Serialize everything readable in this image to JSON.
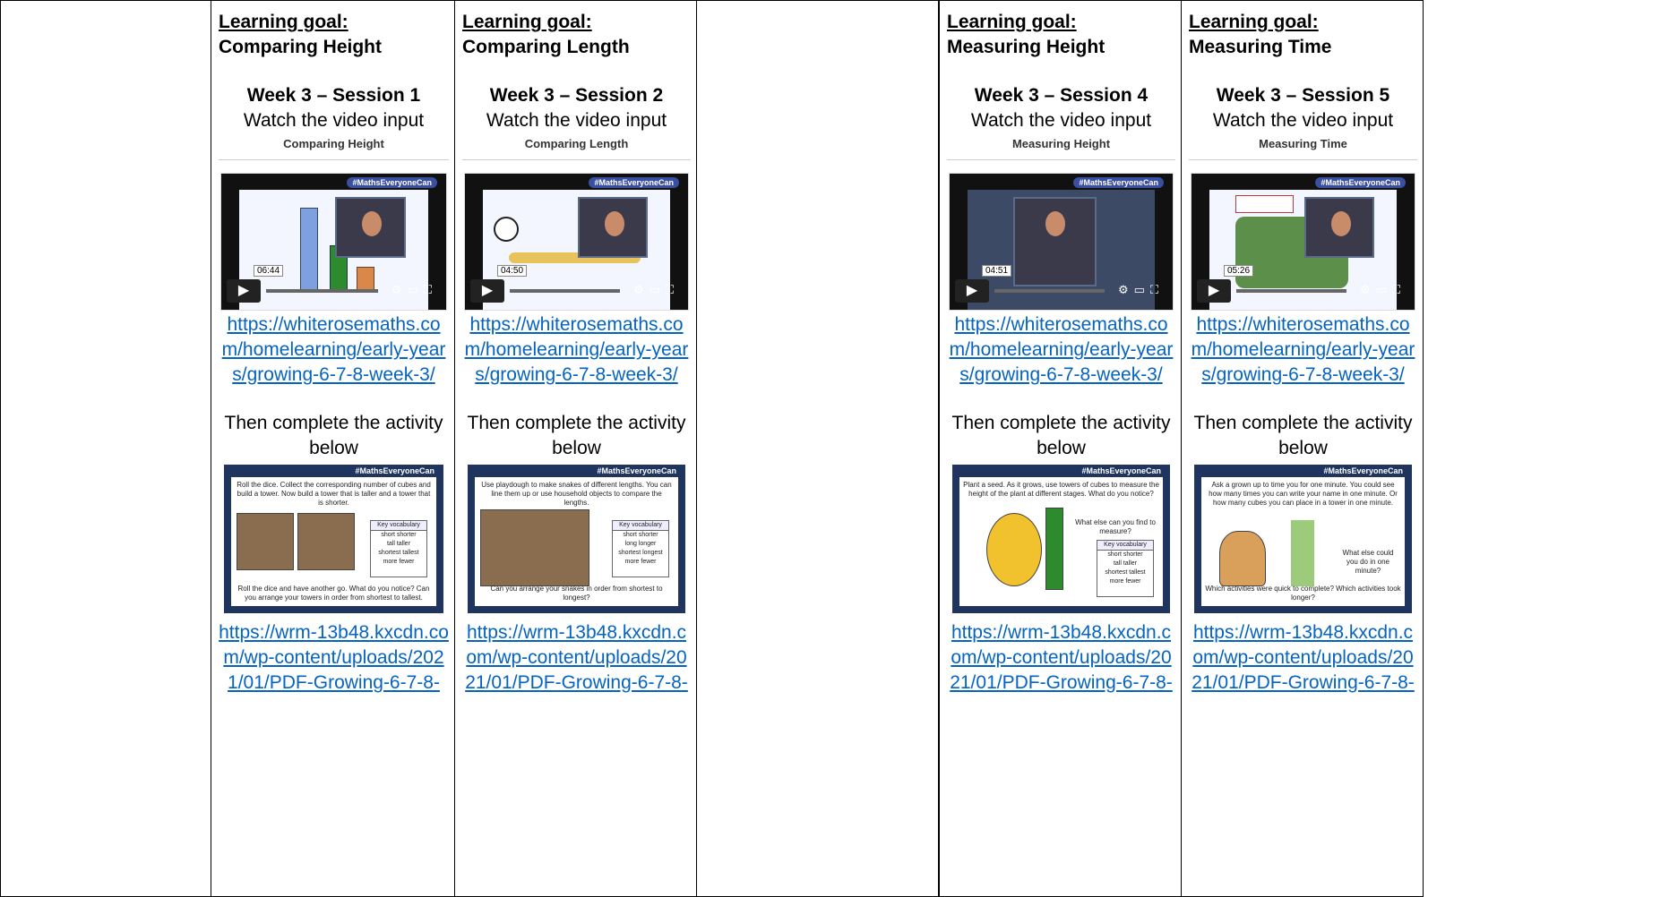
{
  "brand_text": "#MathsEveryoneCan",
  "goal_label": "Learning goal:",
  "columns": [
    {
      "goal": "Comparing Height",
      "week": "Week 3 – Session 1",
      "instruction": "Watch the video input",
      "video_heading": "Comparing Height",
      "video_time": "06:44",
      "video_link": "https://whiterosemaths.com/homelearning/early-years/growing-6-7-8-week-3/",
      "then": "Then complete the activity below",
      "activity_link": "https://wrm-13b48.kxcdn.com/wp-content/uploads/2021/01/PDF-Growing-6-7-8-"
    },
    {
      "goal": "Comparing Length",
      "week": "Week 3 – Session 2",
      "instruction": "Watch the video input",
      "video_heading": "Comparing Length",
      "video_time": "04:50",
      "video_link": "https://whiterosemaths.com/homelearning/early-years/growing-6-7-8-week-3/",
      "then": "Then complete the activity below",
      "activity_link": "https://wrm-13b48.kxcdn.com/wp-content/uploads/2021/01/PDF-Growing-6-7-8-"
    },
    {
      "goal": "Measuring Height",
      "week": "Week 3 – Session 4",
      "instruction": "Watch the video input",
      "video_heading": "Measuring Height",
      "video_time": "04:51",
      "video_link": "https://whiterosemaths.com/homelearning/early-years/growing-6-7-8-week-3/",
      "then": "Then complete the activity below",
      "activity_link": "https://wrm-13b48.kxcdn.com/wp-content/uploads/2021/01/PDF-Growing-6-7-8-"
    },
    {
      "goal": "Measuring Time",
      "week": "Week 3 – Session 5",
      "instruction": "Watch the video input",
      "video_heading": "Measuring Time",
      "video_time": "05:26",
      "video_link": "https://whiterosemaths.com/homelearning/early-years/growing-6-7-8-week-3/",
      "then": "Then complete the activity below",
      "activity_link": "https://wrm-13b48.kxcdn.com/wp-content/uploads/2021/01/PDF-Growing-6-7-8-"
    }
  ],
  "activities": [
    {
      "text": "Roll the dice. Collect the corresponding number of cubes and build a tower. Now build a tower that is taller and a tower that is shorter.",
      "footer": "Roll the dice and have another go. What do you notice? Can you arrange your towers in order from shortest to tallest.",
      "vocab_title": "Key vocabulary",
      "vocab": [
        "short shorter",
        "tall taller",
        "shortest tallest",
        "more fewer"
      ]
    },
    {
      "text": "Use playdough to make snakes of different lengths. You can line them up or use household objects to compare the lengths.",
      "footer": "Can you arrange your snakes in order from shortest to longest?",
      "vocab_title": "Key vocabulary",
      "vocab": [
        "short shorter",
        "long longer",
        "shortest longest",
        "more fewer"
      ]
    },
    {
      "text": "Plant a seed. As it grows, use towers of cubes to measure the height of the plant at different stages. What do you notice?",
      "footer": "What else can you find to measure?",
      "vocab_title": "Key vocabulary",
      "vocab": [
        "short shorter",
        "tall taller",
        "shortest tallest",
        "more fewer"
      ]
    },
    {
      "text": "Ask a grown up to time you for one minute. You could see how many times you can write your name in one minute. Or how many cubes you can place in a tower in one minute.",
      "footer": "Which activities were quick to complete? Which activities took longer?",
      "vocab_title": "What else could you do in one minute?",
      "vocab": []
    }
  ],
  "colors": {
    "link": "#0563c1",
    "slide_bg": "#1f3560",
    "border": "#000000"
  }
}
